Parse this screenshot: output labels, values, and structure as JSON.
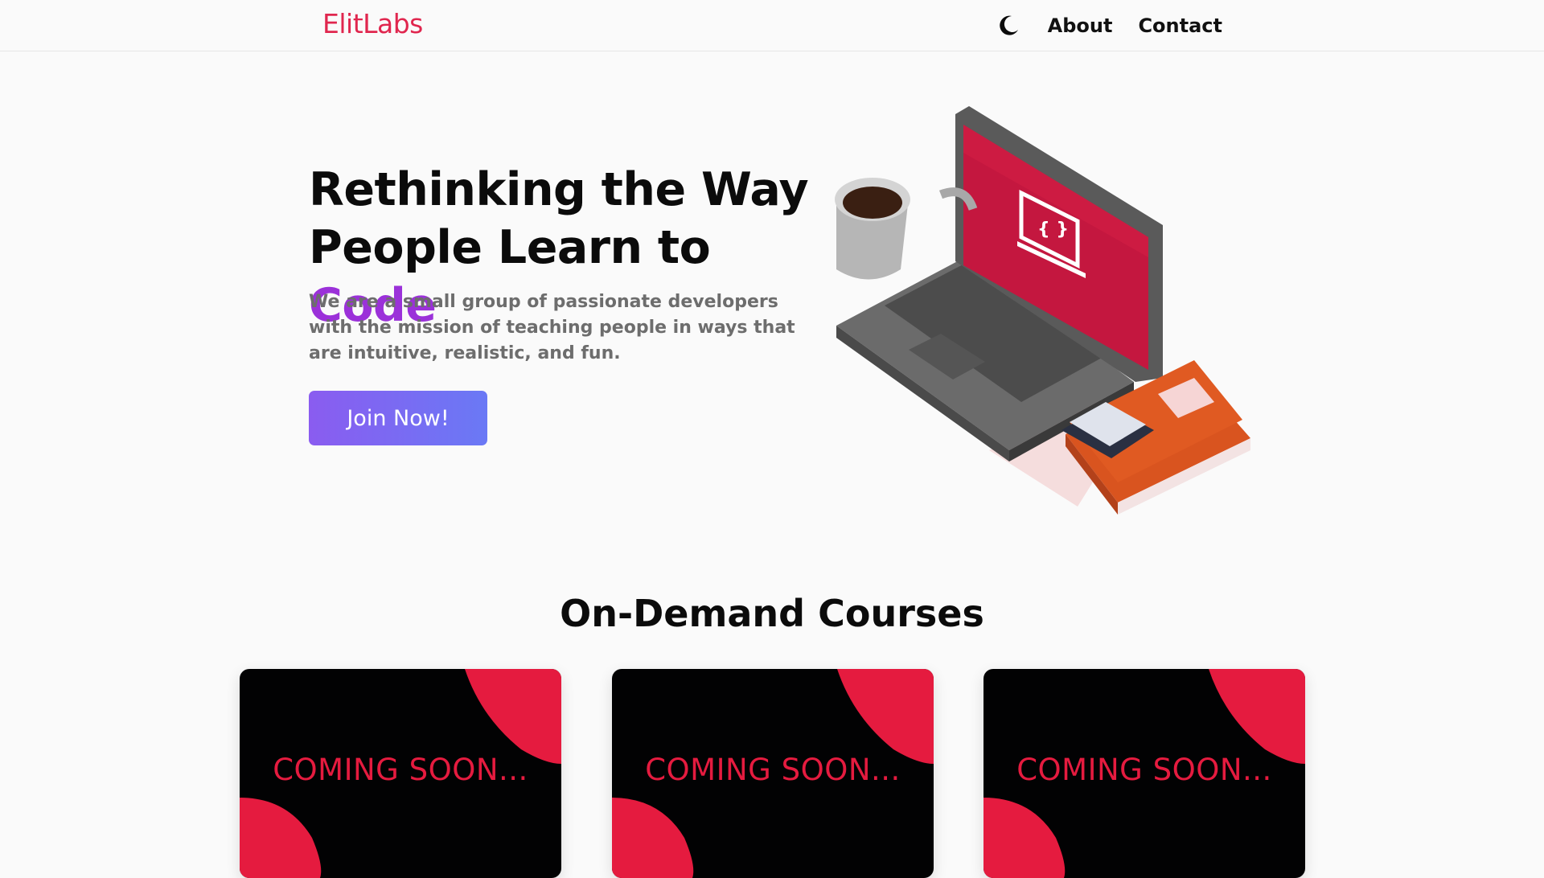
{
  "header": {
    "logo": "ElitLabs",
    "theme_icon": "moon-icon",
    "nav": [
      {
        "label": "About"
      },
      {
        "label": "Contact"
      }
    ]
  },
  "hero": {
    "title_part1": "Rethinking the Way People Learn to ",
    "title_accent": "Code",
    "subtitle": "We are a small group of passionate developers with the mission of teaching people in ways that are intuitive, realistic, and fun.",
    "cta_label": "Join Now!",
    "illustration_icon": "laptop-coffee-books-illustration",
    "screen_glyph": "{ }"
  },
  "courses": {
    "title": "On-Demand Courses",
    "cards": [
      {
        "label": "COMING SOON..."
      },
      {
        "label": "COMING SOON..."
      },
      {
        "label": "COMING SOON..."
      }
    ]
  },
  "colors": {
    "brand": "#e0264e",
    "accent": "#9b31d9",
    "button_start": "#8a5cf0",
    "button_end": "#6a79f5",
    "card_bg": "#020203",
    "card_red": "#e51b3f"
  }
}
